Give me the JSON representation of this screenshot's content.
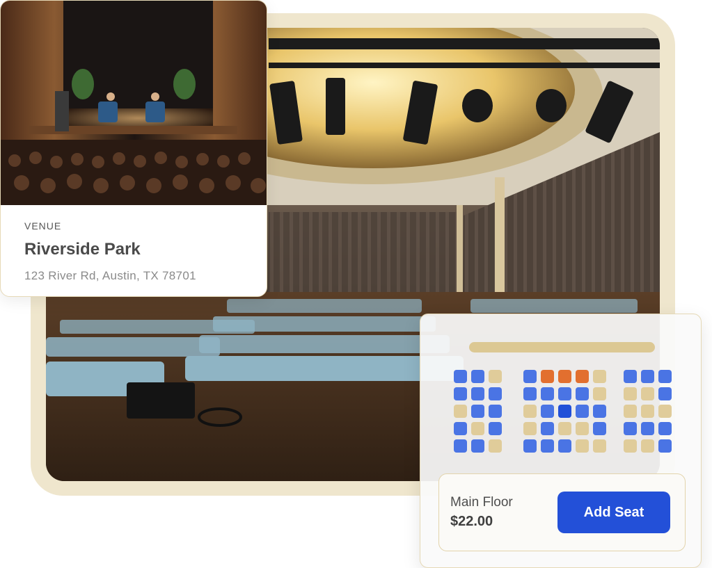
{
  "venue": {
    "kicker": "VENUE",
    "name": "Riverside Park",
    "address": "123 River Rd, Austin, TX 78701"
  },
  "seat_picker": {
    "seat_state_colors": {
      "available": "#4a74e4",
      "sold": "#e0cc9a",
      "held": "#e26f2f",
      "selected": "#2150d8"
    },
    "blocks": [
      {
        "name": "left",
        "rows": [
          [
            "available",
            "available",
            "sold"
          ],
          [
            "available",
            "available",
            "available"
          ],
          [
            "sold",
            "available",
            "available"
          ],
          [
            "available",
            "sold",
            "available"
          ],
          [
            "available",
            "available",
            "sold"
          ]
        ]
      },
      {
        "name": "center",
        "rows": [
          [
            "available",
            "held",
            "held",
            "held",
            "sold"
          ],
          [
            "available",
            "available",
            "available",
            "available",
            "sold"
          ],
          [
            "sold",
            "available",
            "selected",
            "available",
            "available"
          ],
          [
            "sold",
            "available",
            "sold",
            "sold",
            "available"
          ],
          [
            "available",
            "available",
            "available",
            "sold",
            "sold"
          ]
        ]
      },
      {
        "name": "right",
        "rows": [
          [
            "available",
            "available",
            "available"
          ],
          [
            "sold",
            "sold",
            "available"
          ],
          [
            "sold",
            "sold",
            "sold"
          ],
          [
            "available",
            "available",
            "available"
          ],
          [
            "sold",
            "sold",
            "available"
          ]
        ]
      }
    ],
    "section": "Main Floor",
    "price": "$22.00",
    "add_button": "Add Seat"
  },
  "colors": {
    "accent": "#2350d8",
    "frame": "#efe6cd",
    "stage": "#dcc893"
  }
}
